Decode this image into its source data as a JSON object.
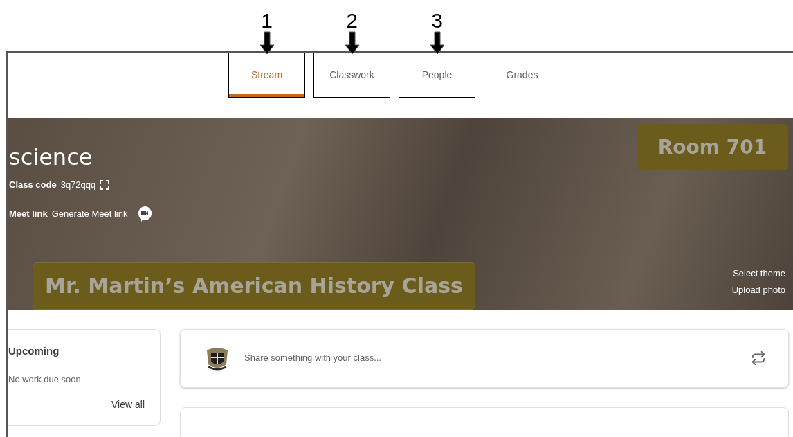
{
  "tabs": [
    {
      "label": "Stream",
      "selected": true,
      "callout": "1"
    },
    {
      "label": "Classwork",
      "selected": false,
      "callout": "2"
    },
    {
      "label": "People",
      "selected": false,
      "callout": "3"
    },
    {
      "label": "Grades",
      "selected": false
    }
  ],
  "banner": {
    "title": "science",
    "class_code_label": "Class code",
    "class_code": "3q72qqq",
    "meet_label": "Meet link",
    "meet_value": "Generate Meet link",
    "class_name_label": "Mr. Martin’s American History Class",
    "room_label": "Room 701",
    "actions": [
      "Select theme",
      "Upload photo"
    ]
  },
  "upcoming": {
    "title": "Upcoming",
    "message": "No work due soon",
    "link": "View all"
  },
  "share": {
    "placeholder": "Share something with your class..."
  }
}
